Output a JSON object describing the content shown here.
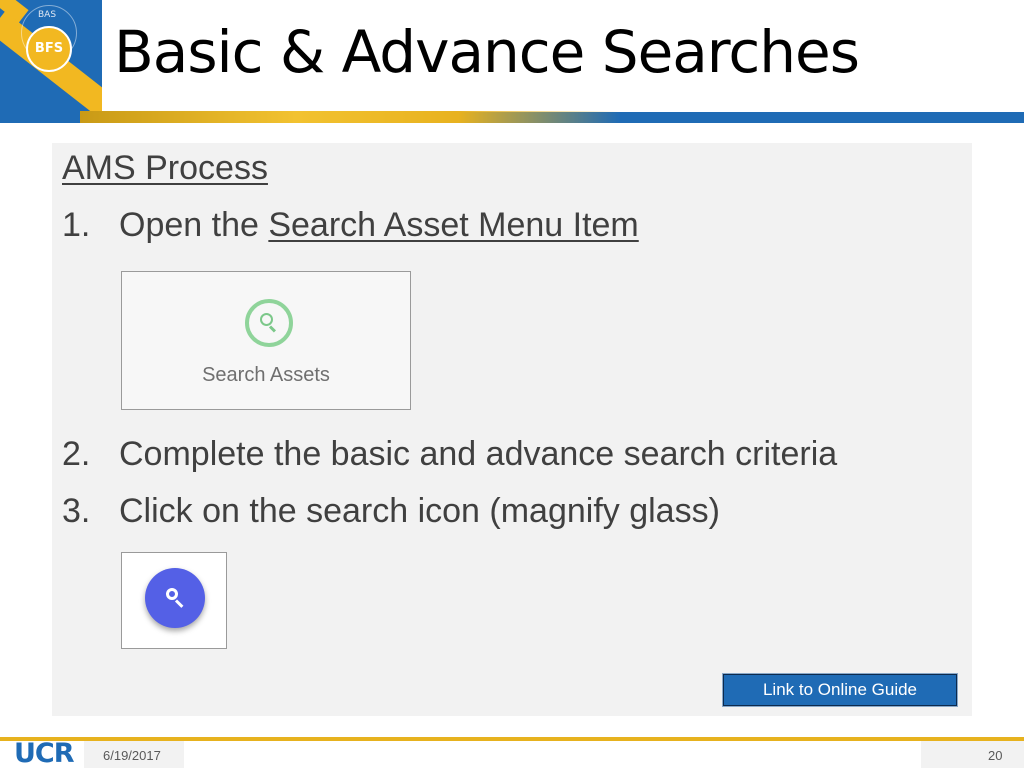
{
  "header": {
    "title": "Basic & Advance Searches",
    "logo": {
      "small_text": "BAS",
      "badge_text": "BFS"
    }
  },
  "content": {
    "heading": "AMS Process",
    "steps": [
      {
        "number": "1.",
        "text_prefix": "Open the ",
        "link_text": "Search Asset Menu Item"
      },
      {
        "number": "2.",
        "text": "Complete the basic and advance search criteria"
      },
      {
        "number": "3.",
        "text": "Click on the search icon (magnify glass)"
      }
    ],
    "thumb_search_assets": {
      "icon": "search-icon",
      "label": "Search Assets"
    },
    "thumb_search_fab": {
      "icon": "search-icon"
    },
    "link_button": "Link to Online Guide"
  },
  "footer": {
    "logo_text": "UCR",
    "date": "6/19/2017",
    "page_number": "20"
  },
  "colors": {
    "brand_blue": "#1f6bb5",
    "brand_gold": "#f2b821",
    "fab_blue": "#5460e6",
    "panel_bg": "#f2f2f2"
  }
}
